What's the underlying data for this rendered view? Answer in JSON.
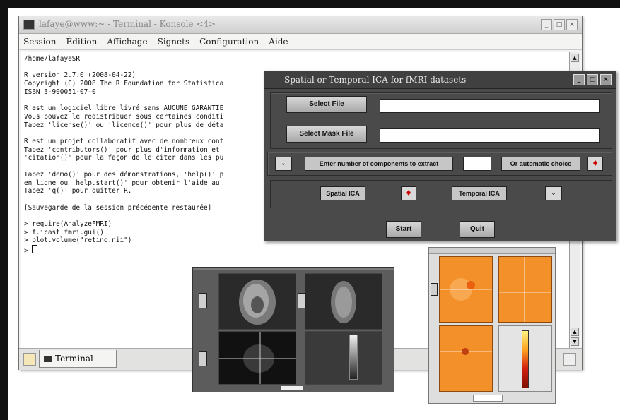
{
  "konsole": {
    "title": "lafaye@www:~ - Terminal - Konsole <4>",
    "menu": [
      "Session",
      "Édition",
      "Affichage",
      "Signets",
      "Configuration",
      "Aide"
    ],
    "terminal_lines": [
      "/home/lafayeSR",
      "",
      "R version 2.7.0 (2008-04-22)",
      "Copyright (C) 2008 The R Foundation for Statistica",
      "ISBN 3-900051-07-0",
      "",
      "R est un logiciel libre livré sans AUCUNE GARANTIE",
      "Vous pouvez le redistribuer sous certaines conditi",
      "Tapez 'license()' ou 'licence()' pour plus de déta",
      "",
      "R est un projet collaboratif avec de nombreux cont",
      "Tapez 'contributors()' pour plus d'information et",
      "'citation()' pour la façon de le citer dans les pu",
      "",
      "Tapez 'demo()' pour des démonstrations, 'help()' p",
      "en ligne ou 'help.start()' pour obtenir l'aide au",
      "Tapez 'q()' pour quitter R.",
      "",
      "[Sauvegarde de la session précédente restaurée]",
      "",
      "> require(AnalyzeFMRI)",
      "> f.icast.fmri.gui()",
      "> plot.volume(\"retino.nii\")",
      "> "
    ],
    "tab_label": "Terminal"
  },
  "ica_dialog": {
    "title": "Spatial or Temporal ICA for fMRI datasets",
    "select_file_label": "Select File",
    "select_mask_label": "Select Mask File",
    "file_value": "",
    "mask_value": "",
    "components_label": "Enter number of components to extract",
    "components_value": "",
    "auto_choice_label": "Or automatic choice",
    "spatial_label": "Spatial ICA",
    "temporal_label": "Temporal ICA",
    "start_label": "Start",
    "quit_label": "Quit",
    "check_mark": "♦",
    "dropdown_glyph": "⌄"
  },
  "colors": {
    "dialog_bg": "#4a4a4a",
    "orange_panel": "#f4902a",
    "check_red": "#cc0000"
  }
}
